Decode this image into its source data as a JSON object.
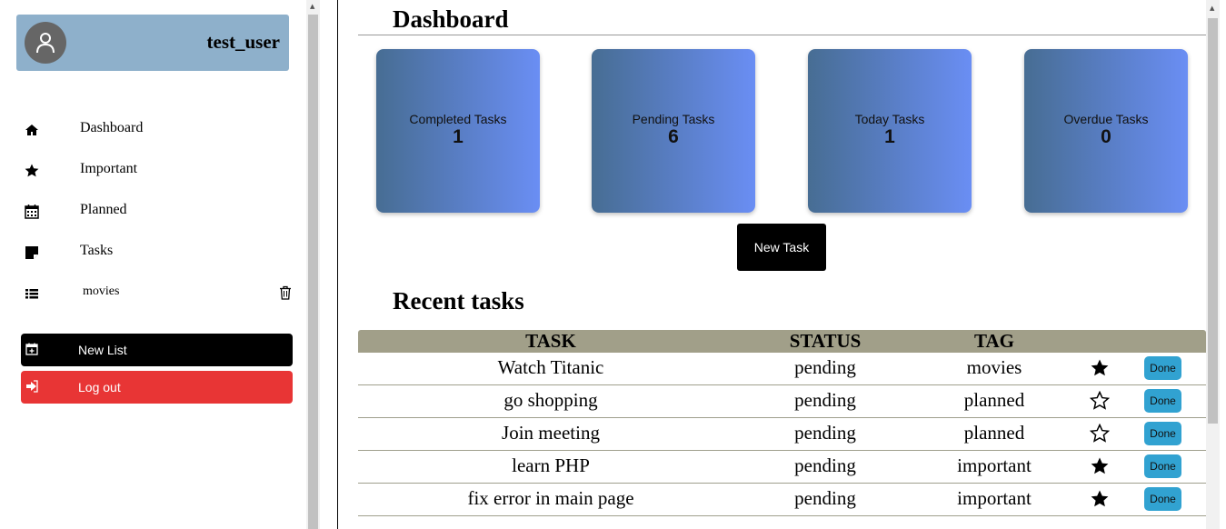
{
  "user": {
    "name": "test_user",
    "avatar_icon": "user-icon"
  },
  "sidebar": {
    "items": [
      {
        "label": "Dashboard",
        "icon": "home-icon"
      },
      {
        "label": "Important",
        "icon": "star-icon"
      },
      {
        "label": "Planned",
        "icon": "calendar-icon"
      },
      {
        "label": "Tasks",
        "icon": "sticky-note-icon"
      }
    ],
    "lists": [
      {
        "label": "movies",
        "icon": "list-icon",
        "delete_icon": "trash-icon"
      }
    ],
    "new_list_label": "New List",
    "logout_label": "Log out"
  },
  "dashboard": {
    "title": "Dashboard",
    "cards": [
      {
        "label": "Completed Tasks",
        "value": "1"
      },
      {
        "label": "Pending Tasks",
        "value": "6"
      },
      {
        "label": "Today Tasks",
        "value": "1"
      },
      {
        "label": "Overdue Tasks",
        "value": "0"
      }
    ],
    "new_task_label": "New Task"
  },
  "recent": {
    "title": "Recent tasks",
    "columns": [
      "TASK",
      "STATUS",
      "TAG"
    ],
    "rows": [
      {
        "task": "Watch Titanic",
        "status": "pending",
        "tag": "movies",
        "starred": true,
        "action": "Done"
      },
      {
        "task": "go shopping",
        "status": "pending",
        "tag": "planned",
        "starred": false,
        "action": "Done"
      },
      {
        "task": "Join meeting",
        "status": "pending",
        "tag": "planned",
        "starred": false,
        "action": "Done"
      },
      {
        "task": "learn PHP",
        "status": "pending",
        "tag": "important",
        "starred": true,
        "action": "Done"
      },
      {
        "task": "fix error in main page",
        "status": "pending",
        "tag": "important",
        "starred": true,
        "action": "Done"
      }
    ]
  },
  "colors": {
    "user_card": "#8eb0cb",
    "logout": "#e83535",
    "card_gradient_start": "#476d93",
    "card_gradient_end": "#6a8ef4",
    "table_header": "#a19f89",
    "done_button": "#31a2d1"
  }
}
